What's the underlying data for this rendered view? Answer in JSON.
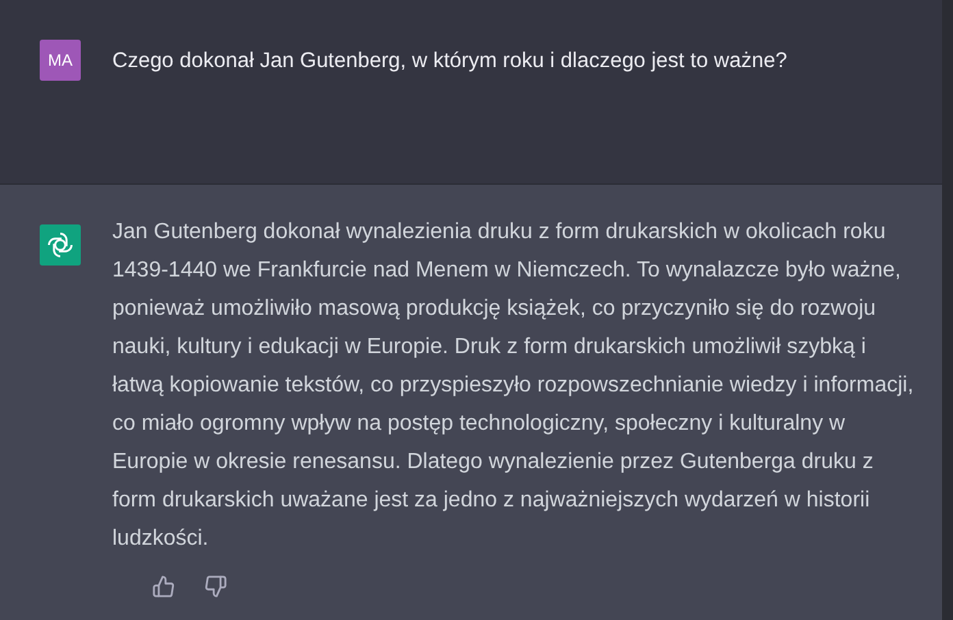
{
  "messages": [
    {
      "kind": "user",
      "avatar": "MA",
      "text": "Czego dokonał Jan Gutenberg, w którym roku i dlaczego jest to ważne?"
    },
    {
      "kind": "assistant",
      "text": "Jan Gutenberg dokonał wynalezienia druku z form drukarskich w okolicach roku 1439-1440 we Frankfurcie nad Menem w Niemczech. To wynalazcze było ważne, ponieważ umożliwiło masową produkcję książek, co przyczyniło się do rozwoju nauki, kultury i edukacji w Europie. Druk z form drukarskich umożliwił szybką i łatwą kopiowanie tekstów, co przyspieszyło rozpowszechnianie wiedzy i informacji, co miało ogromny wpływ na postęp technologiczny, społeczny i kulturalny w Europie w okresie renesansu. Dlatego wynalezienie przez Gutenberga druku z form drukarskich uważane jest za jedno z najważniejszych wydarzeń w historii ludzkości."
    }
  ]
}
